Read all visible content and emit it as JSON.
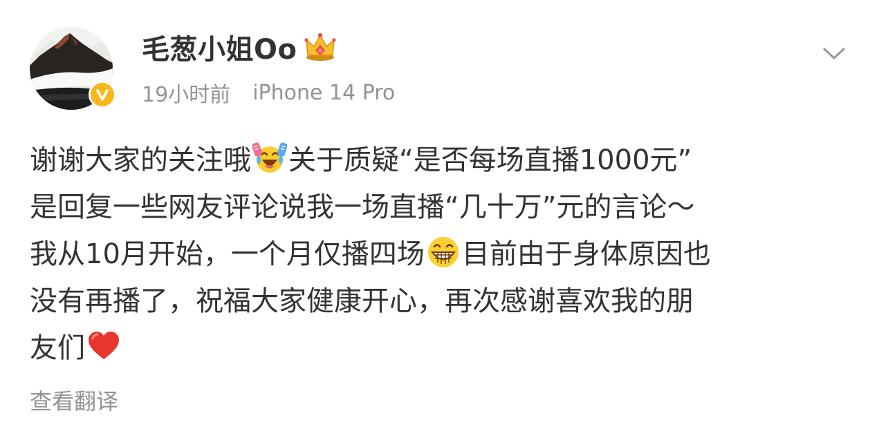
{
  "post": {
    "author": {
      "name": "毛葱小姐Oo",
      "verified": true,
      "badge_letter": "v",
      "avatar_icon": "mountain-mist-photo",
      "vip_icon": "crown-icon"
    },
    "meta": {
      "time": "19小时前",
      "device": "iPhone 14 Pro"
    },
    "content": {
      "line1_a": "谢谢大家的关注哦",
      "line1_b": "关于质疑“是否每场直播1000元”",
      "line2": "是回复一些网友评论说我一场直播“几十万”元的言论～",
      "line3_a": "我从10月开始，一个月仅播四场",
      "line3_b": "目前由于身体原因也",
      "line4": "没有再播了，祝福大家健康开心，再次感谢喜欢我的朋",
      "line5": "友们"
    },
    "emojis": [
      "laughing-cheering-emoji",
      "grinning-teeth-emoji",
      "red-heart-emoji"
    ],
    "translate_label": "查看翻译"
  },
  "colors": {
    "text_primary": "#333333",
    "text_secondary": "#939393",
    "verified_badge": "#f6b81c",
    "heart": "#e8352e"
  }
}
